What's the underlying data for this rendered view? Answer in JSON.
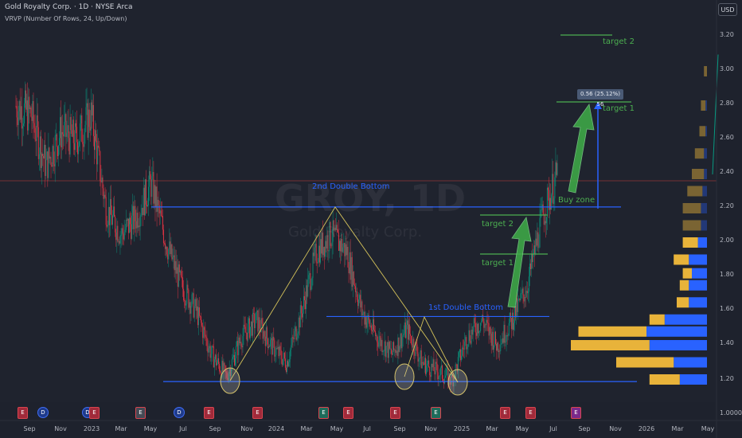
{
  "header": {
    "symbol_line": "Gold Royalty Corp. · 1D · NYSE Arca",
    "indicator_line": "VRVP (Number Of Rows, 24, Up/Down)",
    "currency_button": "USD"
  },
  "watermark": {
    "ticker": "GROY, 1D",
    "name": "Gold Royalty Corp."
  },
  "y_axis": {
    "ticks": [
      "3.20",
      "3.00",
      "2.80",
      "2.60",
      "2.40",
      "2.20",
      "2.00",
      "1.80",
      "1.60",
      "1.40",
      "1.20",
      "1.0000"
    ]
  },
  "x_axis": {
    "ticks": [
      "Sep",
      "Nov",
      "2023",
      "Mar",
      "May",
      "Jul",
      "Sep",
      "Nov",
      "2024",
      "Mar",
      "May",
      "Jul",
      "Sep",
      "Nov",
      "2025",
      "Mar",
      "May",
      "Jul",
      "Sep",
      "Nov",
      "2026",
      "Mar",
      "May"
    ]
  },
  "annotations": {
    "second_double_bottom": "2nd Double Bottom",
    "first_double_bottom": "1st Double Bottom",
    "buy_zone": "Buy zone",
    "target1_upper": "target 1",
    "target2_upper": "target 2",
    "target1_lower": "target 1",
    "target2_lower": "target 2",
    "measure_label": "0.56 (25.12%) 56"
  },
  "events": [
    {
      "type": "E",
      "color": "#a02a3a"
    },
    {
      "type": "D",
      "color": "#1e3a8a"
    },
    {
      "type": "D",
      "color": "#1e3a8a"
    },
    {
      "type": "E",
      "color": "#a02a3a"
    },
    {
      "type": "E",
      "color": "#444a55"
    },
    {
      "type": "D",
      "color": "#1e3a8a"
    },
    {
      "type": "E",
      "color": "#a02a3a"
    },
    {
      "type": "E",
      "color": "#a02a3a"
    },
    {
      "type": "E",
      "color": "#1d6b5a"
    },
    {
      "type": "E",
      "color": "#a02a3a"
    },
    {
      "type": "E",
      "color": "#a02a3a"
    },
    {
      "type": "E",
      "color": "#1d6b5a"
    },
    {
      "type": "E",
      "color": "#a02a3a"
    },
    {
      "type": "E",
      "color": "#a02a3a"
    },
    {
      "type": "E",
      "color": "#7a2a8a"
    }
  ],
  "colors": {
    "background": "#1e222d",
    "up_candle": "#089981",
    "down_candle": "#f23645",
    "annotation_green": "#4caf50",
    "annotation_blue": "#2962ff",
    "pattern_line": "#d4c25a",
    "volume_up": "#2962ff",
    "volume_down": "#e8b33a"
  },
  "chart_data": {
    "type": "candlestick",
    "y_scale": "log",
    "ylim": [
      1.0,
      3.2
    ],
    "support_level": 1.19,
    "neckline_first": 1.57,
    "neckline_second": 2.21,
    "resistance_red": 2.36,
    "price_series": [
      {
        "date": "2022-08",
        "close": 2.8
      },
      {
        "date": "2022-09",
        "close": 2.75
      },
      {
        "date": "2022-10",
        "close": 2.45
      },
      {
        "date": "2022-11",
        "close": 2.65
      },
      {
        "date": "2022-12",
        "close": 2.6
      },
      {
        "date": "2023-01",
        "close": 2.75
      },
      {
        "date": "2023-02",
        "close": 2.2
      },
      {
        "date": "2023-03",
        "close": 2.05
      },
      {
        "date": "2023-04",
        "close": 2.15
      },
      {
        "date": "2023-05",
        "close": 2.35
      },
      {
        "date": "2023-06",
        "close": 2.0
      },
      {
        "date": "2023-07",
        "close": 1.75
      },
      {
        "date": "2023-08",
        "close": 1.6
      },
      {
        "date": "2023-09",
        "close": 1.35
      },
      {
        "date": "2023-10",
        "close": 1.22
      },
      {
        "date": "2023-11",
        "close": 1.45
      },
      {
        "date": "2023-12",
        "close": 1.55
      },
      {
        "date": "2024-01",
        "close": 1.4
      },
      {
        "date": "2024-02",
        "close": 1.3
      },
      {
        "date": "2024-03",
        "close": 1.6
      },
      {
        "date": "2024-04",
        "close": 1.95
      },
      {
        "date": "2024-05",
        "close": 2.05
      },
      {
        "date": "2024-06",
        "close": 1.95
      },
      {
        "date": "2024-07",
        "close": 1.6
      },
      {
        "date": "2024-08",
        "close": 1.45
      },
      {
        "date": "2024-09",
        "close": 1.35
      },
      {
        "date": "2024-10",
        "close": 1.5
      },
      {
        "date": "2024-11",
        "close": 1.3
      },
      {
        "date": "2024-12",
        "close": 1.25
      },
      {
        "date": "2025-01",
        "close": 1.2
      },
      {
        "date": "2025-02",
        "close": 1.45
      },
      {
        "date": "2025-03",
        "close": 1.55
      },
      {
        "date": "2025-04",
        "close": 1.4
      },
      {
        "date": "2025-05",
        "close": 1.55
      },
      {
        "date": "2025-06",
        "close": 1.75
      },
      {
        "date": "2025-07",
        "close": 2.15
      },
      {
        "date": "2025-08",
        "close": 2.4
      }
    ],
    "volume_profile": [
      {
        "price": 1.2,
        "up": 18,
        "down": 20
      },
      {
        "price": 1.3,
        "up": 22,
        "down": 38
      },
      {
        "price": 1.4,
        "up": 38,
        "down": 52
      },
      {
        "price": 1.48,
        "up": 40,
        "down": 45
      },
      {
        "price": 1.55,
        "up": 28,
        "down": 10
      },
      {
        "price": 1.65,
        "up": 12,
        "down": 8
      },
      {
        "price": 1.75,
        "up": 12,
        "down": 6
      },
      {
        "price": 1.82,
        "up": 10,
        "down": 6
      },
      {
        "price": 1.9,
        "up": 12,
        "down": 10
      },
      {
        "price": 2.0,
        "up": 6,
        "down": 10
      },
      {
        "price": 2.1,
        "up": 4,
        "down": 12
      },
      {
        "price": 2.2,
        "up": 4,
        "down": 12
      },
      {
        "price": 2.3,
        "up": 3,
        "down": 10
      },
      {
        "price": 2.4,
        "up": 2,
        "down": 8
      },
      {
        "price": 2.52,
        "up": 2,
        "down": 6
      },
      {
        "price": 2.65,
        "up": 1,
        "down": 4
      },
      {
        "price": 2.8,
        "up": 1,
        "down": 3
      },
      {
        "price": 3.0,
        "up": 0,
        "down": 2
      }
    ]
  }
}
